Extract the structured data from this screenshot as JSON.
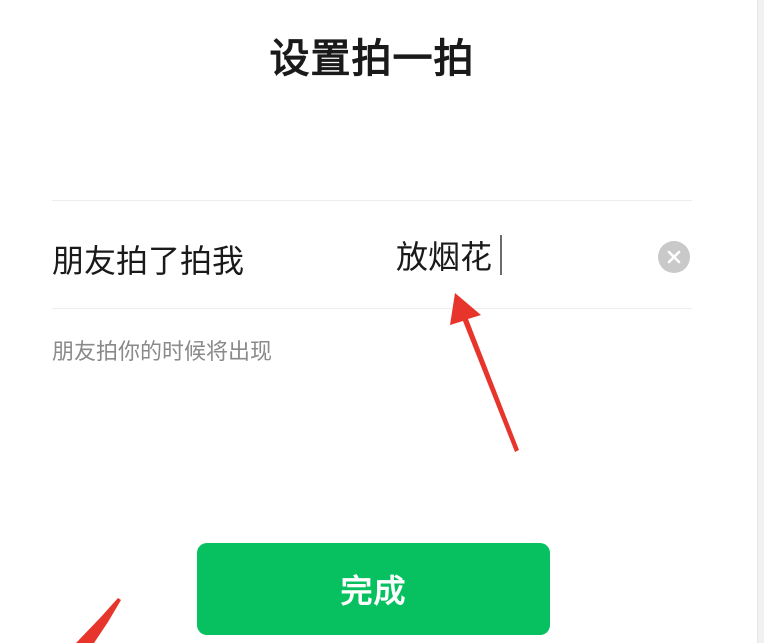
{
  "header": {
    "title": "设置拍一拍"
  },
  "form": {
    "row_label": "朋友拍了拍我",
    "input_value": "放烟花",
    "hint": "朋友拍你的时候将出现"
  },
  "actions": {
    "done_label": "完成"
  },
  "colors": {
    "primary_green": "#07c160",
    "annotation_red": "#e8352b"
  },
  "icons": {
    "clear": "clear-icon",
    "annotation": "red-arrow-annotation"
  }
}
